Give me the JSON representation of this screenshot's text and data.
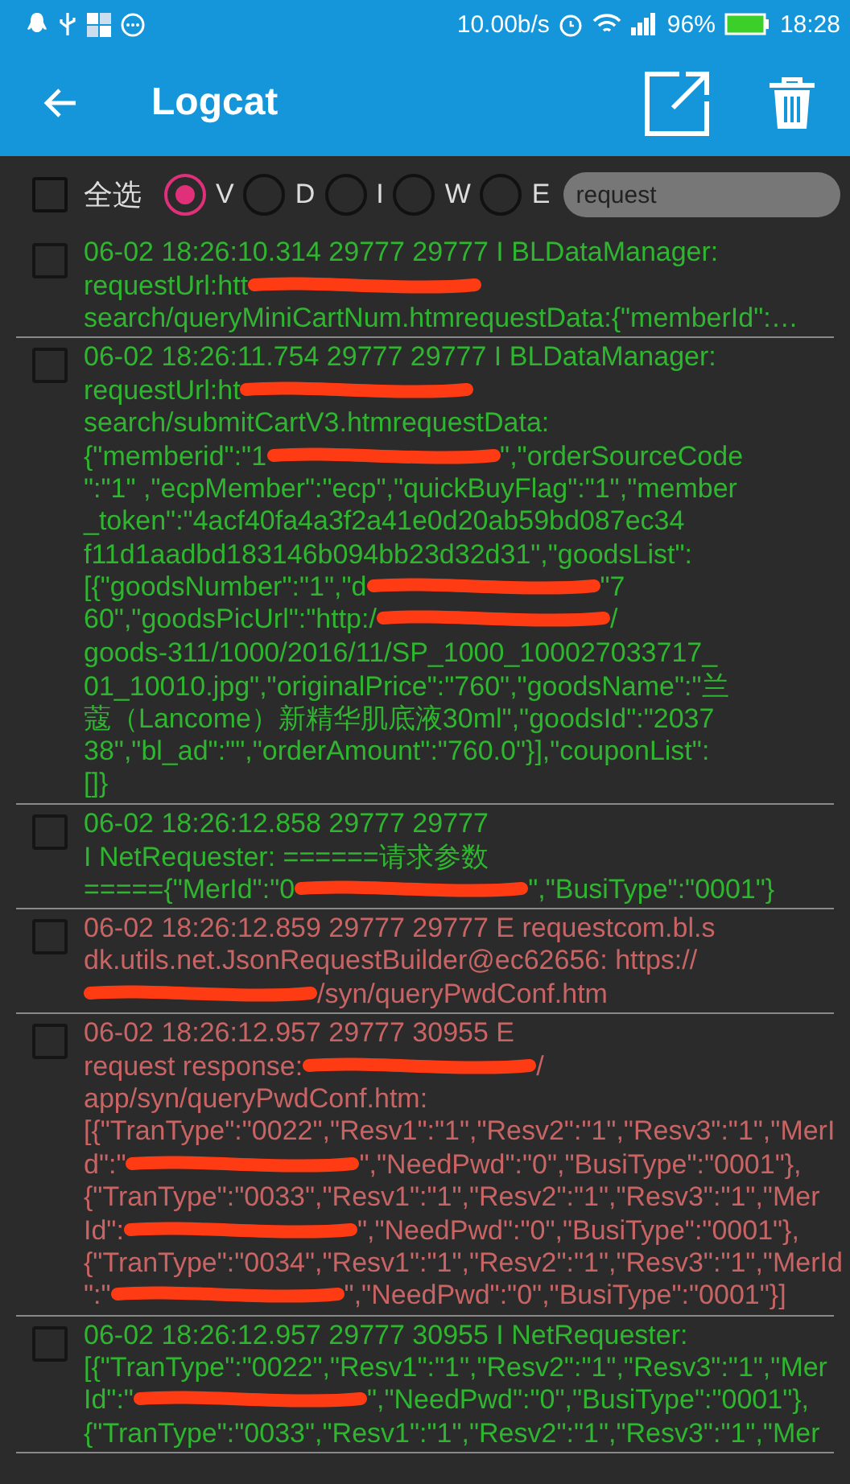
{
  "status_bar": {
    "speed": "10.00b/s",
    "battery": "96%",
    "time": "18:28"
  },
  "app_bar": {
    "title": "Logcat"
  },
  "filter_bar": {
    "select_all": {
      "label": "全选",
      "checked": false
    },
    "levels": [
      {
        "label": "V",
        "selected": true
      },
      {
        "label": "D",
        "selected": false
      },
      {
        "label": "I",
        "selected": false
      },
      {
        "label": "W",
        "selected": false
      },
      {
        "label": "E",
        "selected": false
      }
    ],
    "search": {
      "value": "request"
    }
  },
  "entries": [
    {
      "color": "#2fb52f",
      "checked": false,
      "lines": [
        [
          {
            "kind": "text",
            "text": "06-02 18:26:10.314 29777 29777 I BLDataManager:"
          }
        ],
        [
          {
            "kind": "text",
            "text": "requestUrl:htt"
          },
          {
            "kind": "redaction"
          }
        ],
        [
          {
            "kind": "text",
            "text": "search/queryMiniCartNum.htmrequestData:{\"memberId\":…"
          }
        ]
      ]
    },
    {
      "color": "#2fb52f",
      "checked": false,
      "lines": [
        [
          {
            "kind": "text",
            "text": "06-02 18:26:11.754 29777 29777 I BLDataManager:"
          }
        ],
        [
          {
            "kind": "text",
            "text": "requestUrl:ht"
          },
          {
            "kind": "redaction"
          }
        ],
        [
          {
            "kind": "text",
            "text": "search/submitCartV3.htmrequestData:"
          }
        ],
        [
          {
            "kind": "text",
            "text": "{\"memberid\":\"1"
          },
          {
            "kind": "redaction"
          },
          {
            "kind": "text",
            "text": "\",\"orderSourceCode"
          }
        ],
        [
          {
            "kind": "text",
            "text": "\":\"1\" ,\"ecpMember\":\"ecp\",\"quickBuyFlag\":\"1\",\"member"
          }
        ],
        [
          {
            "kind": "text",
            "text": "_token\":\"4acf40fa4a3f2a41e0d20ab59bd087ec34"
          }
        ],
        [
          {
            "kind": "text",
            "text": "f11d1aadbd183146b094bb23d32d31\",\"goodsList\":"
          }
        ],
        [
          {
            "kind": "text",
            "text": "[{\"goodsNumber\":\"1\",\"d"
          },
          {
            "kind": "redaction"
          },
          {
            "kind": "text",
            "text": "\"7"
          }
        ],
        [
          {
            "kind": "text",
            "text": "60\",\"goodsPicUrl\":\"http:/"
          },
          {
            "kind": "redaction"
          },
          {
            "kind": "text",
            "text": "/"
          }
        ],
        [
          {
            "kind": "text",
            "text": "goods-311/1000/2016/11/SP_1000_100027033717_"
          }
        ],
        [
          {
            "kind": "text",
            "text": "01_10010.jpg\",\"originalPrice\":\"760\",\"goodsName\":\"兰"
          }
        ],
        [
          {
            "kind": "text",
            "text": "蔻（Lancome）新精华肌底液30ml\",\"goodsId\":\"2037"
          }
        ],
        [
          {
            "kind": "text",
            "text": "38\",\"bl_ad\":\"\",\"orderAmount\":\"760.0\"}],\"couponList\":"
          }
        ],
        [
          {
            "kind": "text",
            "text": "[]}"
          }
        ]
      ]
    },
    {
      "color": "#2fb52f",
      "checked": false,
      "lines": [
        [
          {
            "kind": "text",
            "text": "06-02 18:26:12.858 29777 29777"
          }
        ],
        [
          {
            "kind": "text",
            "text": "I NetRequester: ======请求参数"
          }
        ],
        [
          {
            "kind": "text",
            "text": "====={\"MerId\":\"0"
          },
          {
            "kind": "redaction"
          },
          {
            "kind": "text",
            "text": "\",\"BusiType\":\"0001\"}"
          }
        ]
      ]
    },
    {
      "color": "#c86464",
      "checked": false,
      "lines": [
        [
          {
            "kind": "text",
            "text": "06-02 18:26:12.859 29777 29777 E requestcom.bl.s"
          }
        ],
        [
          {
            "kind": "text",
            "text": "dk.utils.net.JsonRequestBuilder@ec62656: https://"
          }
        ],
        [
          {
            "kind": "redaction"
          },
          {
            "kind": "text",
            "text": "/syn/queryPwdConf.htm"
          }
        ]
      ]
    },
    {
      "color": "#c86464",
      "checked": false,
      "lines": [
        [
          {
            "kind": "text",
            "text": "06-02 18:26:12.957 29777 30955 E"
          }
        ],
        [
          {
            "kind": "text",
            "text": "request response:"
          },
          {
            "kind": "redaction"
          },
          {
            "kind": "text",
            "text": "/"
          }
        ],
        [
          {
            "kind": "text",
            "text": "app/syn/queryPwdConf.htm:"
          }
        ],
        [
          {
            "kind": "text",
            "text": "[{\"TranType\":\"0022\",\"Resv1\":\"1\",\"Resv2\":\"1\",\"Resv3\":\"1\",\"MerI"
          }
        ],
        [
          {
            "kind": "text",
            "text": "d\":\""
          },
          {
            "kind": "redaction"
          },
          {
            "kind": "text",
            "text": "\",\"NeedPwd\":\"0\",\"BusiType\":\"0001\"},"
          }
        ],
        [
          {
            "kind": "text",
            "text": "{\"TranType\":\"0033\",\"Resv1\":\"1\",\"Resv2\":\"1\",\"Resv3\":\"1\",\"Mer"
          }
        ],
        [
          {
            "kind": "text",
            "text": "Id\":"
          },
          {
            "kind": "redaction"
          },
          {
            "kind": "text",
            "text": "\",\"NeedPwd\":\"0\",\"BusiType\":\"0001\"},"
          }
        ],
        [
          {
            "kind": "text",
            "text": "{\"TranType\":\"0034\",\"Resv1\":\"1\",\"Resv2\":\"1\",\"Resv3\":\"1\",\"MerId"
          }
        ],
        [
          {
            "kind": "text",
            "text": "\":\""
          },
          {
            "kind": "redaction"
          },
          {
            "kind": "text",
            "text": "\",\"NeedPwd\":\"0\",\"BusiType\":\"0001\"}]"
          }
        ]
      ]
    },
    {
      "color": "#2fb52f",
      "checked": false,
      "lines": [
        [
          {
            "kind": "text",
            "text": "06-02 18:26:12.957 29777 30955 I NetRequester:"
          }
        ],
        [
          {
            "kind": "text",
            "text": "[{\"TranType\":\"0022\",\"Resv1\":\"1\",\"Resv2\":\"1\",\"Resv3\":\"1\",\"Mer"
          }
        ],
        [
          {
            "kind": "text",
            "text": "Id\":\""
          },
          {
            "kind": "redaction"
          },
          {
            "kind": "text",
            "text": "\",\"NeedPwd\":\"0\",\"BusiType\":\"0001\"},"
          }
        ],
        [
          {
            "kind": "text",
            "text": "{\"TranType\":\"0033\",\"Resv1\":\"1\",\"Resv2\":\"1\",\"Resv3\":\"1\",\"Mer"
          }
        ]
      ]
    }
  ]
}
